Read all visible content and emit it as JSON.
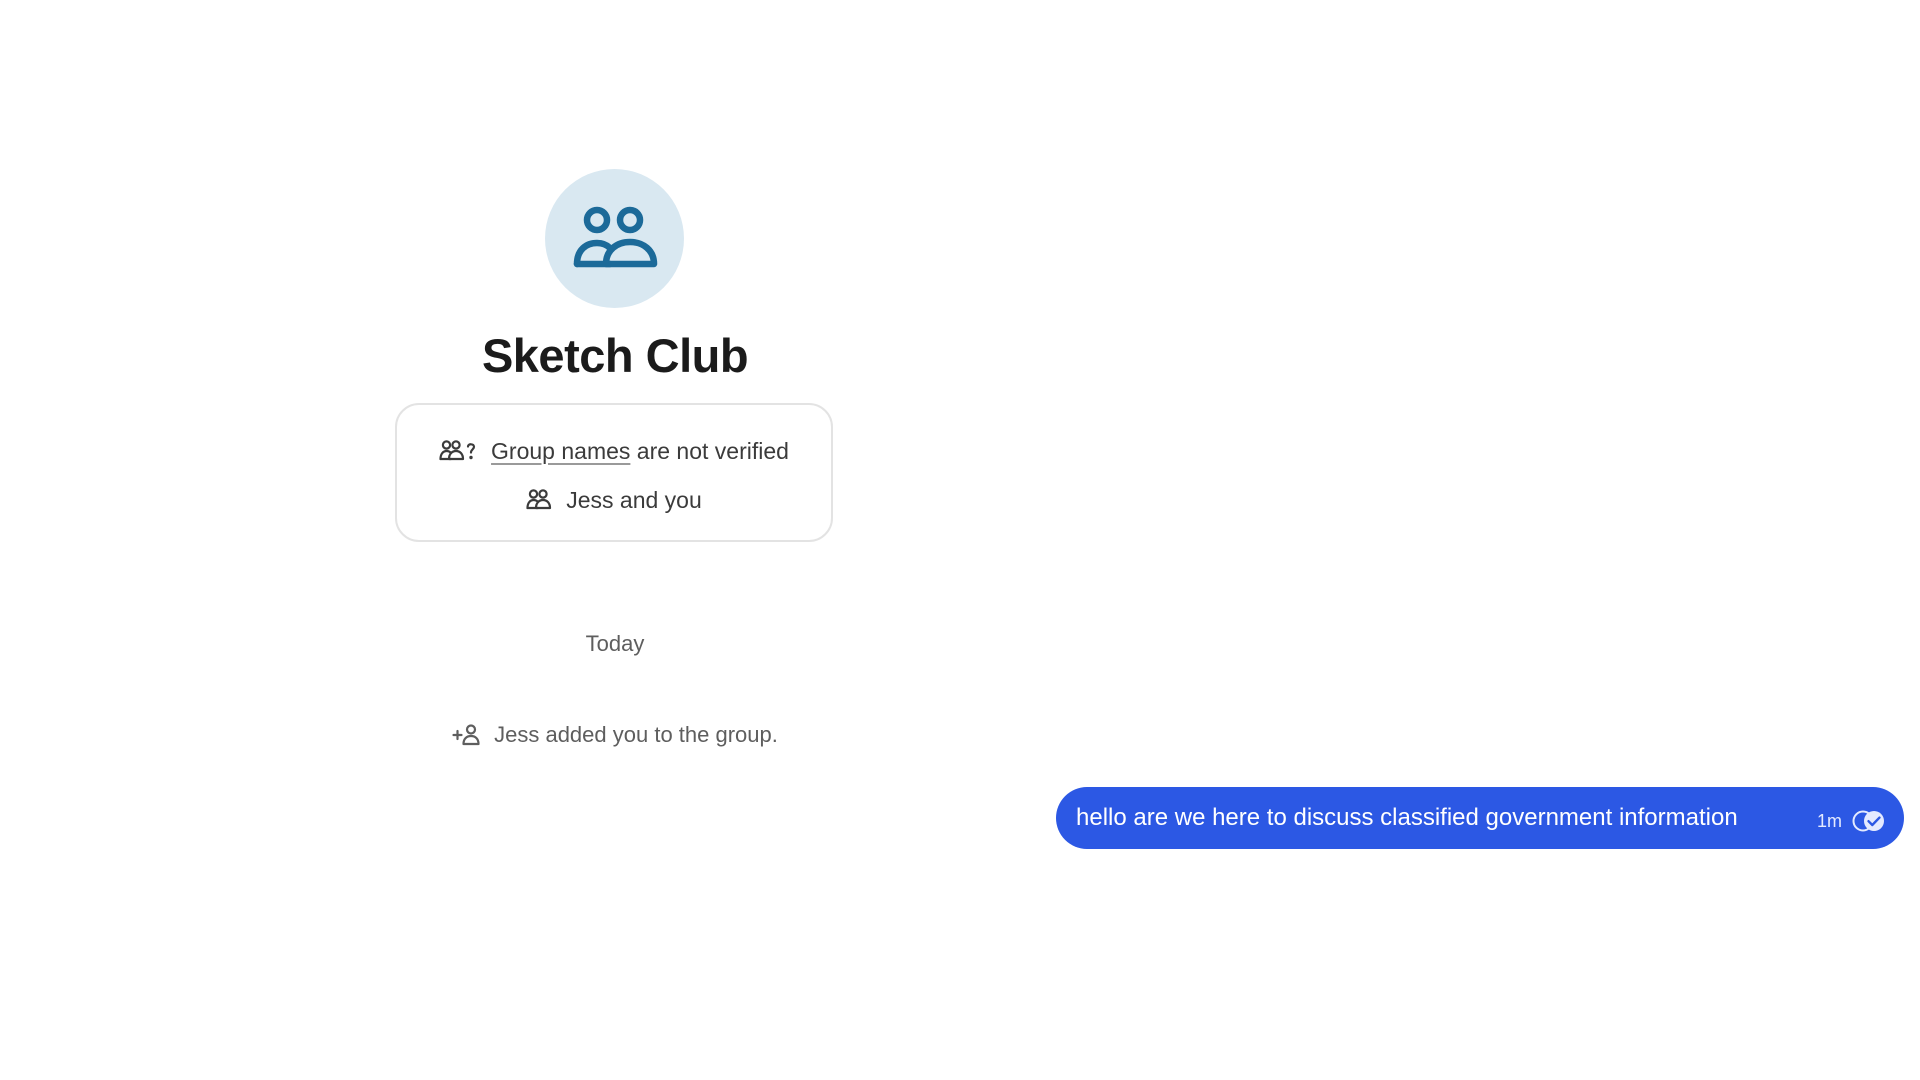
{
  "group": {
    "name": "Sketch Club",
    "avatar_icon": "group-icon"
  },
  "info_card": {
    "names_link": "Group names",
    "names_suffix": "are not verified",
    "members": "Jess and you"
  },
  "timeline": {
    "date_divider": "Today",
    "system_message": "Jess added you to the group."
  },
  "messages": [
    {
      "direction": "outgoing",
      "text": "hello are we here to discuss classified government information",
      "time": "1m",
      "status_icon": "delivered-check-icon"
    }
  ],
  "colors": {
    "bubble": "#2c58e4",
    "avatar_bg": "#d9e8f1",
    "avatar_icon": "#1c6a99"
  }
}
